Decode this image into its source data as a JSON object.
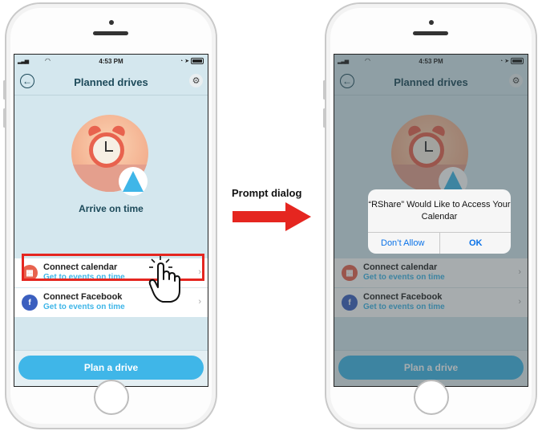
{
  "caption": "Prompt dialog",
  "status_bar": {
    "time": "4:53 PM"
  },
  "app": {
    "title": "Planned drives",
    "arrive_text": "Arrive on time",
    "rows": [
      {
        "title": "Connect calendar",
        "subtitle": "Get to events on time",
        "icon": "calendar-icon"
      },
      {
        "title": "Connect Facebook",
        "subtitle": "Get to events on time",
        "icon": "facebook-icon"
      }
    ],
    "plan_button": "Plan a drive"
  },
  "dialog": {
    "message": "“RShare” Would Like to Access Your Calendar",
    "deny": "Don’t Allow",
    "ok": "OK"
  },
  "colors": {
    "accent": "#3fb6e8",
    "highlight": "#e52620",
    "calendar": "#e8624e",
    "facebook": "#3b5fbf",
    "title": "#1d4a5a"
  }
}
